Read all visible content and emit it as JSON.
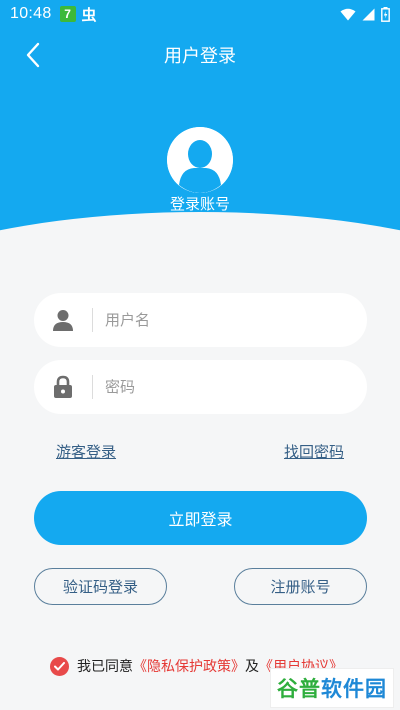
{
  "status_bar": {
    "time": "10:48",
    "badge": "7",
    "bug_glyph": "虫"
  },
  "nav": {
    "title": "用户登录",
    "back_icon": "chevron-left-icon"
  },
  "profile": {
    "label": "登录账号"
  },
  "form": {
    "username_placeholder": "用户名",
    "password_placeholder": "密码",
    "guest_login": "游客登录",
    "forgot_password": "找回密码",
    "login_button": "立即登录",
    "sms_login": "验证码登录",
    "register": "注册账号"
  },
  "agreement": {
    "prefix": "我已同意",
    "privacy": "《隐私保护政策》",
    "and": "及",
    "terms": "《用户协议》"
  },
  "watermark": {
    "part1": "谷普",
    "part2": "软件园"
  },
  "colors": {
    "primary": "#14a9f0",
    "link": "#355f86",
    "danger": "#e53935"
  }
}
